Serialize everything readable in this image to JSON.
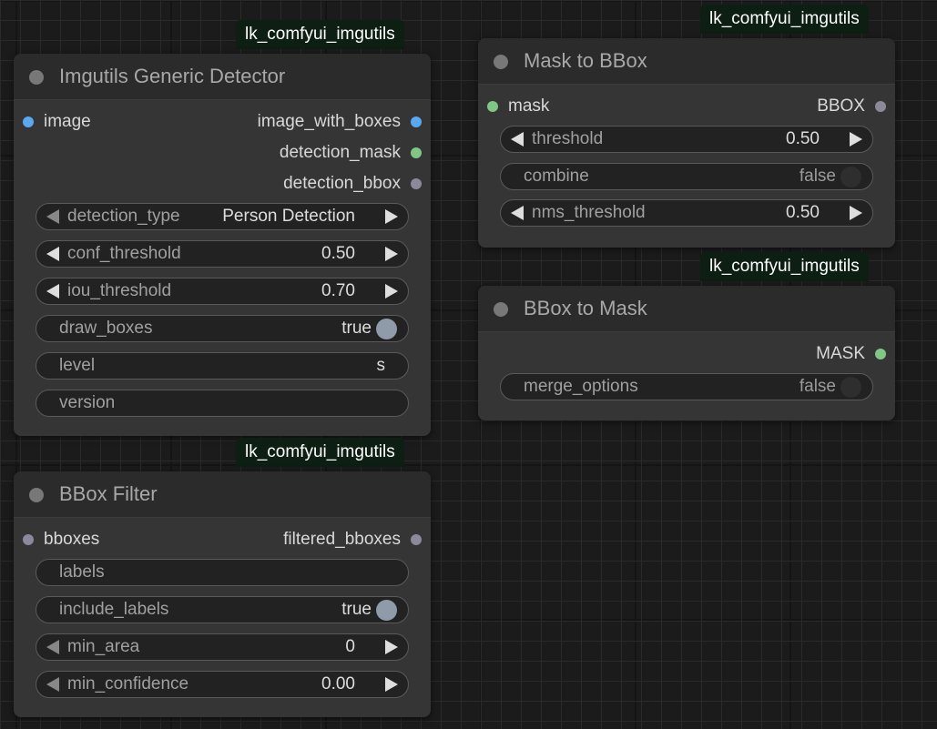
{
  "colors": {
    "slot_image": "#5aa9f0",
    "slot_mask": "#80c684",
    "slot_bbox": "#8c8a9a",
    "toggle_on": "#8f9ba8",
    "toggle_off": "#2e2e2e"
  },
  "nodes": {
    "detector": {
      "badge": "lk_comfyui_imgutils",
      "title": "Imgutils Generic Detector",
      "input_image": "image",
      "output_image_with_boxes": "image_with_boxes",
      "output_detection_mask": "detection_mask",
      "output_detection_bbox": "detection_bbox",
      "widgets": {
        "detection_type": {
          "label": "detection_type",
          "value": "Person Detection"
        },
        "conf_threshold": {
          "label": "conf_threshold",
          "value": "0.50"
        },
        "iou_threshold": {
          "label": "iou_threshold",
          "value": "0.70"
        },
        "draw_boxes": {
          "label": "draw_boxes",
          "value": "true"
        },
        "level": {
          "label": "level",
          "value": "s"
        },
        "version": {
          "label": "version",
          "value": ""
        }
      }
    },
    "bbox_filter": {
      "badge": "lk_comfyui_imgutils",
      "title": "BBox Filter",
      "input_bboxes": "bboxes",
      "output_filtered_bboxes": "filtered_bboxes",
      "widgets": {
        "labels": {
          "label": "labels",
          "value": ""
        },
        "include_labels": {
          "label": "include_labels",
          "value": "true"
        },
        "min_area": {
          "label": "min_area",
          "value": "0"
        },
        "min_confidence": {
          "label": "min_confidence",
          "value": "0.00"
        }
      }
    },
    "mask_to_bbox": {
      "badge": "lk_comfyui_imgutils",
      "title": "Mask to BBox",
      "input_mask": "mask",
      "output_bbox": "BBOX",
      "widgets": {
        "threshold": {
          "label": "threshold",
          "value": "0.50"
        },
        "combine": {
          "label": "combine",
          "value": "false"
        },
        "nms_threshold": {
          "label": "nms_threshold",
          "value": "0.50"
        }
      }
    },
    "bbox_to_mask": {
      "badge": "lk_comfyui_imgutils",
      "title": "BBox to Mask",
      "output_mask": "MASK",
      "widgets": {
        "merge_options": {
          "label": "merge_options",
          "value": "false"
        }
      }
    }
  }
}
